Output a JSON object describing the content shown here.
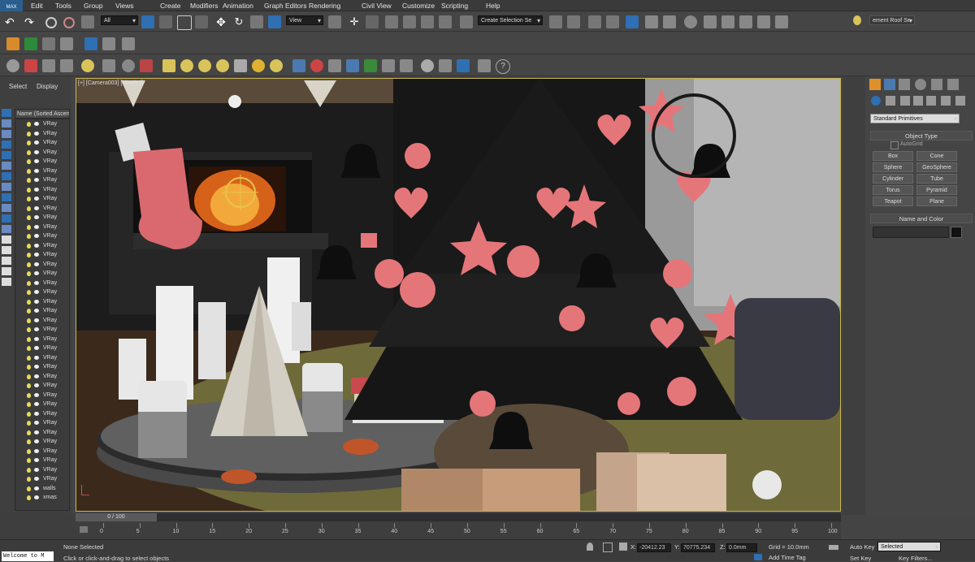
{
  "menubar": {
    "logo": "MAX",
    "items": [
      "Edit",
      "Tools",
      "Group",
      "Views",
      "Create",
      "Modifiers",
      "Animation",
      "Graph Editors",
      "Rendering",
      "Civil View",
      "Customize",
      "Scripting",
      "Help"
    ]
  },
  "main_toolbar": {
    "filter_value": "All",
    "view_value": "View",
    "selection_set_placeholder": "Create Selection Se",
    "workspace_value": "ement Roof Se"
  },
  "left_panel": {
    "tabs": [
      "Select",
      "Display"
    ],
    "column_header": "Name (Sorted Ascen",
    "items": [
      "VRay",
      "VRay",
      "VRay",
      "VRay",
      "VRay",
      "VRay",
      "VRay",
      "VRay",
      "VRay",
      "VRay",
      "VRay",
      "VRay",
      "VRay",
      "VRay",
      "VRay",
      "VRay",
      "VRay",
      "VRay",
      "VRay",
      "VRay",
      "VRay",
      "VRay",
      "VRay",
      "VRay",
      "VRay",
      "VRay",
      "VRay",
      "VRay",
      "VRay",
      "VRay",
      "VRay",
      "VRay",
      "VRay",
      "VRay",
      "VRay",
      "VRay",
      "VRay",
      "VRay",
      "VRay",
      "walls",
      "xmas"
    ]
  },
  "viewport": {
    "label": "[+] [Camera003] [Shaded]"
  },
  "command_panel": {
    "category_value": "Standard Primitives",
    "object_type_title": "Object Type",
    "autogrid_label": "AutoGrid",
    "buttons": [
      "Box",
      "Cone",
      "Sphere",
      "GeoSphere",
      "Cylinder",
      "Tube",
      "Torus",
      "Pyramid",
      "Teapot",
      "Plane"
    ],
    "name_color_title": "Name and Color"
  },
  "timeline": {
    "frame_counter": "0 / 100",
    "ticks": [
      "0",
      "5",
      "10",
      "15",
      "20",
      "25",
      "30",
      "35",
      "40",
      "45",
      "50",
      "55",
      "60",
      "65",
      "70",
      "75",
      "80",
      "85",
      "90",
      "95",
      "100"
    ]
  },
  "status": {
    "script_listener": "Welcome to M",
    "selection_status": "None Selected",
    "prompt": "Click or click-and-drag to select objects",
    "x_label": "X:",
    "x_value": "-20412.23",
    "y_label": "Y:",
    "y_value": "70775.234",
    "z_label": "Z:",
    "z_value": "0.0mm",
    "grid": "Grid = 10.0mm",
    "auto_key": "Auto Key",
    "auto_key_value": "Selected",
    "set_key": "Set Key",
    "key_filters": "Key Filters...",
    "add_time_tag": "Add Time Tag"
  },
  "colors": {
    "accent_blue": "#2f6fb3",
    "viewport_border": "#c9b455",
    "ornament_pink": "#e4767a"
  }
}
